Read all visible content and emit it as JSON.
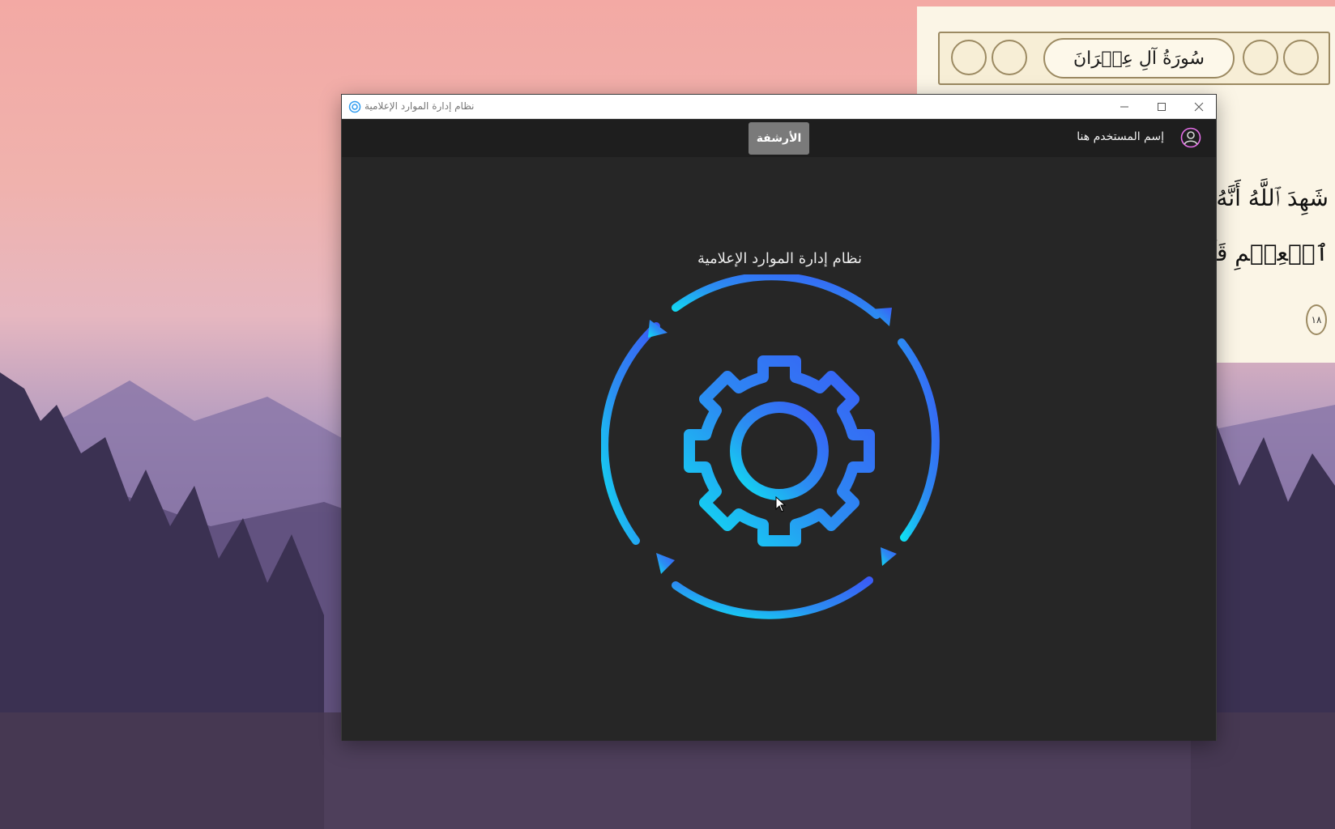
{
  "window": {
    "title": "نظام إدارة الموارد الإعلامية",
    "controls": {
      "minimize_icon": "minimize-icon",
      "maximize_icon": "maximize-icon",
      "close_icon": "close-icon"
    }
  },
  "appbar": {
    "archive_label": "الأرشفة",
    "user_name": "إسم المستخدم هنا",
    "avatar_icon": "user-circle-icon"
  },
  "main": {
    "title": "نظام إدارة الموارد الإعلامية",
    "illustration_icon": "gear-refresh-icon"
  },
  "background": {
    "quran_surah_title": "سُورَةُ آلِ عِمۡرَانَ",
    "quran_line_1": "شَهِدَ ٱللَّهُ أَنَّهُۥ لَآ",
    "quran_line_2": "ٱلۡعِلۡمِ قَآئِمَۢا بِٱلۡقِ",
    "ayah_number": "١٨"
  },
  "colors": {
    "accent_blue": "#2f6cf5",
    "accent_cyan": "#10d8f0",
    "window_bg": "#262626",
    "appbar_bg": "#1e1e1e",
    "archive_button_bg": "#7a7a7a"
  }
}
